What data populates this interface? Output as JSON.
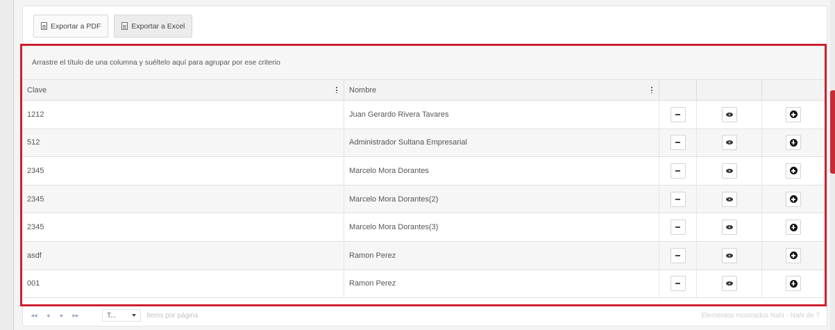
{
  "toolbar": {
    "pdf_label": "Exportar a PDF",
    "excel_label": "Exportar a Excel"
  },
  "grid": {
    "group_hint": "Arrastre el título de una columna y suéltelo aquí para agrupar por ese criterio",
    "columns": [
      "Clave",
      "Nombre"
    ],
    "rows": [
      {
        "clave": "1212",
        "nombre": "Juan Gerardo Rivera Tavares"
      },
      {
        "clave": "512",
        "nombre": "Administrador Sultana Empresarial"
      },
      {
        "clave": "2345",
        "nombre": "Marcelo Mora Dorantes"
      },
      {
        "clave": "2345",
        "nombre": "Marcelo Mora Dorantes(2)"
      },
      {
        "clave": "2345",
        "nombre": "Marcelo Mora Dorantes(3)"
      },
      {
        "clave": "asdf",
        "nombre": "Ramon Perez"
      },
      {
        "clave": "001",
        "nombre": "Ramon Perez"
      }
    ],
    "row_actions": [
      "dash-icon",
      "eye-icon",
      "plus-circle-icon"
    ]
  },
  "pager": {
    "page_size_value": "T...",
    "page_size_label": "Items por página",
    "info": "Elementos mostrados NaN - NaN de 7"
  },
  "colors": {
    "highlight_border": "#cc1f2f",
    "side_marker": "#c92a35"
  }
}
